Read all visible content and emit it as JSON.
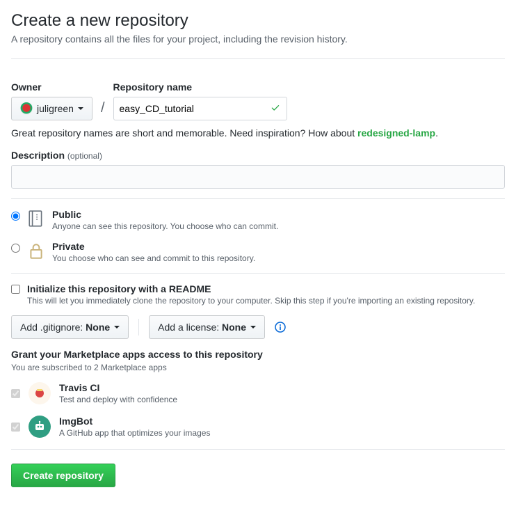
{
  "header": {
    "title": "Create a new repository",
    "subtitle": "A repository contains all the files for your project, including the revision history."
  },
  "owner": {
    "label": "Owner",
    "username": "juligreen"
  },
  "repo": {
    "label": "Repository name",
    "value": "easy_CD_tutorial"
  },
  "inspiration": {
    "prefix": "Great repository names are short and memorable. Need inspiration? How about ",
    "suggestion": "redesigned-lamp",
    "suffix": "."
  },
  "description": {
    "label": "Description",
    "optional": "(optional)",
    "value": ""
  },
  "visibility": {
    "public": {
      "title": "Public",
      "sub": "Anyone can see this repository. You choose who can commit."
    },
    "private": {
      "title": "Private",
      "sub": "You choose who can see and commit to this repository."
    }
  },
  "init": {
    "title": "Initialize this repository with a README",
    "sub": "This will let you immediately clone the repository to your computer. Skip this step if you're importing an existing repository."
  },
  "dropdowns": {
    "gitignore_prefix": "Add .gitignore: ",
    "gitignore_value": "None",
    "license_prefix": "Add a license: ",
    "license_value": "None"
  },
  "apps": {
    "heading": "Grant your Marketplace apps access to this repository",
    "sub": "You are subscribed to 2 Marketplace apps",
    "list": [
      {
        "name": "Travis CI",
        "desc": "Test and deploy with confidence"
      },
      {
        "name": "ImgBot",
        "desc": "A GitHub app that optimizes your images"
      }
    ]
  },
  "submit": {
    "label": "Create repository"
  }
}
